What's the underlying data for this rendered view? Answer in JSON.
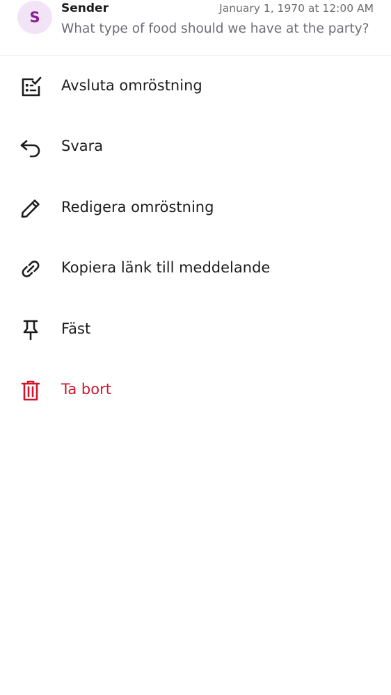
{
  "header": {
    "avatar_letter": "S",
    "sender": "Sender",
    "timestamp": "January 1, 1970 at 12:00 AM",
    "preview": "What type of food should we have at the party?"
  },
  "menu": {
    "items": [
      {
        "label": "Avsluta omröstning",
        "icon": "poll-end-icon"
      },
      {
        "label": "Svara",
        "icon": "reply-icon"
      },
      {
        "label": "Redigera omröstning",
        "icon": "pencil-icon"
      },
      {
        "label": "Kopiera länk till meddelande",
        "icon": "link-icon"
      },
      {
        "label": "Fäst",
        "icon": "pin-icon"
      },
      {
        "label": "Ta bort",
        "icon": "trash-icon"
      }
    ]
  },
  "colors": {
    "danger": "#d2152c",
    "avatar_bg": "#f3e3f6",
    "avatar_fg": "#8a1f96",
    "text_primary": "#1c1c1e",
    "text_secondary": "#6c6c74"
  }
}
